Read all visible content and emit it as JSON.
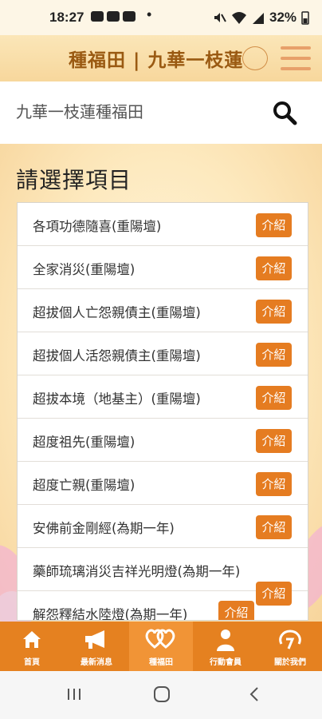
{
  "status_bar": {
    "time": "18:27",
    "dot": "•",
    "battery": "32%"
  },
  "header": {
    "title": "種福田 | 九華一枝蓮",
    "menu_icon": "hamburger-menu-icon"
  },
  "search": {
    "value": "九華一枝蓮種福田",
    "icon": "search-icon"
  },
  "main": {
    "section_title": "請選擇項目",
    "intro_label": "介紹",
    "items": [
      {
        "label": "各項功德隨喜(重陽壇)"
      },
      {
        "label": "全家消災(重陽壇)"
      },
      {
        "label": "超拔個人亡怨親債主(重陽壇)"
      },
      {
        "label": "超拔個人活怨親債主(重陽壇)"
      },
      {
        "label": "超拔本境（地基主）(重陽壇)"
      },
      {
        "label": "超度祖先(重陽壇)"
      },
      {
        "label": "超度亡親(重陽壇)"
      },
      {
        "label": "安佛前金剛經(為期一年)"
      },
      {
        "label": "藥師琉璃消災吉祥光明燈(為期一年)"
      },
      {
        "label": "解怨釋結水陸燈(為期一年)"
      }
    ]
  },
  "bottom_nav": {
    "items": [
      {
        "label": "首頁",
        "icon": "home-icon"
      },
      {
        "label": "最新消息",
        "icon": "megaphone-icon"
      },
      {
        "label": "種福田",
        "icon": "hearts-icon"
      },
      {
        "label": "行動會員",
        "icon": "person-icon"
      },
      {
        "label": "關於我們",
        "icon": "about-icon"
      }
    ],
    "active_index": 2
  },
  "colors": {
    "accent": "#e57c21",
    "title": "#9a5a12"
  }
}
